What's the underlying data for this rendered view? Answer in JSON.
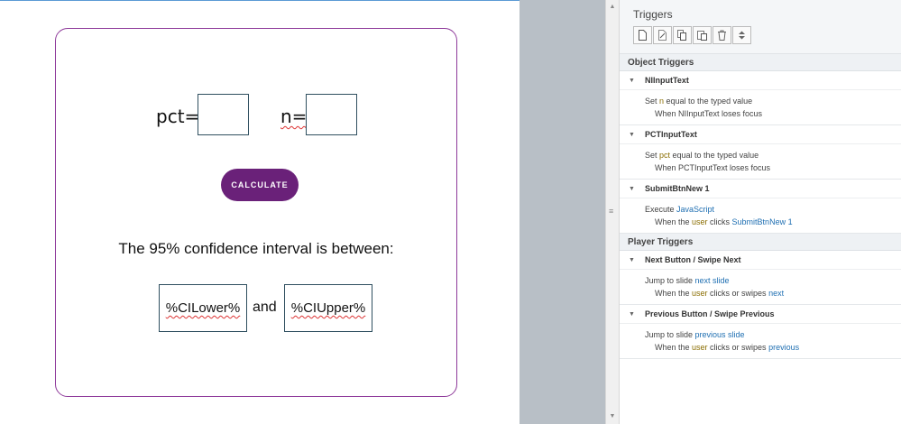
{
  "slide": {
    "pct_label": "pct=",
    "n_label": "n=",
    "calculate_label": "CALCULATE",
    "ci_text": "The 95% confidence interval is between:",
    "lower_value": "%CILower%",
    "and_label": "and",
    "upper_value": "%CIUpper%"
  },
  "panel": {
    "title": "Triggers",
    "toolbar": {
      "icons": [
        "new-trigger-icon",
        "edit-trigger-icon",
        "copy-icon",
        "paste-icon",
        "delete-icon",
        "move-up-down-icon"
      ]
    },
    "object_triggers_label": "Object Triggers",
    "player_triggers_label": "Player Triggers",
    "groups": [
      {
        "name": "NIInputText",
        "action_prefix": "Set ",
        "action_var": "n",
        "action_suffix": " equal to the typed value",
        "cond_prefix": "When NIInputText loses focus"
      },
      {
        "name": "PCTInputText",
        "action_prefix": "Set ",
        "action_var": "pct",
        "action_suffix": " equal to the typed value",
        "cond_prefix": "When PCTInputText loses focus"
      },
      {
        "name": "SubmitBtnNew 1",
        "action_prefix": "Execute ",
        "action_link": "JavaScript",
        "cond_prefix": "When the ",
        "cond_user": "user",
        "cond_mid": " clicks ",
        "cond_link": "SubmitBtnNew 1"
      },
      {
        "name": "Next Button / Swipe Next",
        "action_prefix": "Jump to slide ",
        "action_link": "next slide",
        "cond_prefix": "When the ",
        "cond_user": "user",
        "cond_mid": " clicks or swipes ",
        "cond_link": "next"
      },
      {
        "name": "Previous Button / Swipe Previous",
        "action_prefix": "Jump to slide ",
        "action_link": "previous slide",
        "cond_prefix": "When the ",
        "cond_user": "user",
        "cond_mid": " clicks or swipes ",
        "cond_link": "previous"
      }
    ]
  },
  "colors": {
    "slide_border": "#8e3a9a",
    "button": "#6a2179",
    "link": "#1f6fb2",
    "variable": "#8a6d00",
    "offstage": "#b8bfc6"
  }
}
